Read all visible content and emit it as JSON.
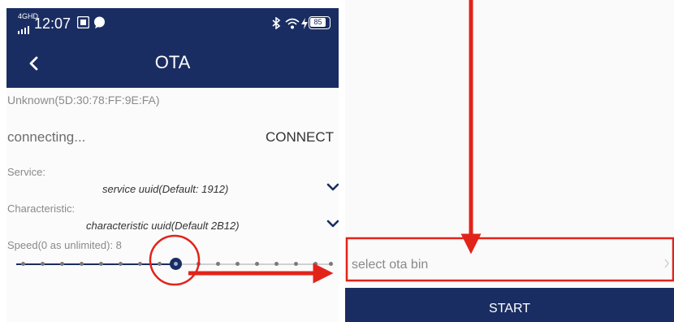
{
  "status": {
    "network": "4GHD",
    "time": "12:07",
    "battery": "85"
  },
  "header": {
    "title": "OTA"
  },
  "device": {
    "name": "Unknown(5D:30:78:FF:9E:FA)"
  },
  "connection": {
    "status": "connecting...",
    "button": "CONNECT"
  },
  "service": {
    "label": "Service:",
    "value": "service uuid(Default: 1912)"
  },
  "characteristic": {
    "label": "Characteristic:",
    "value": "characteristic uuid(Default 2B12)"
  },
  "speed": {
    "label": "Speed(0 as unlimited): 8",
    "value": 8,
    "min": 0,
    "max": 16
  },
  "ota": {
    "select_label": "select ota bin",
    "start_label": "START"
  },
  "colors": {
    "primary": "#1a2d62",
    "annotation": "#e2231a"
  }
}
